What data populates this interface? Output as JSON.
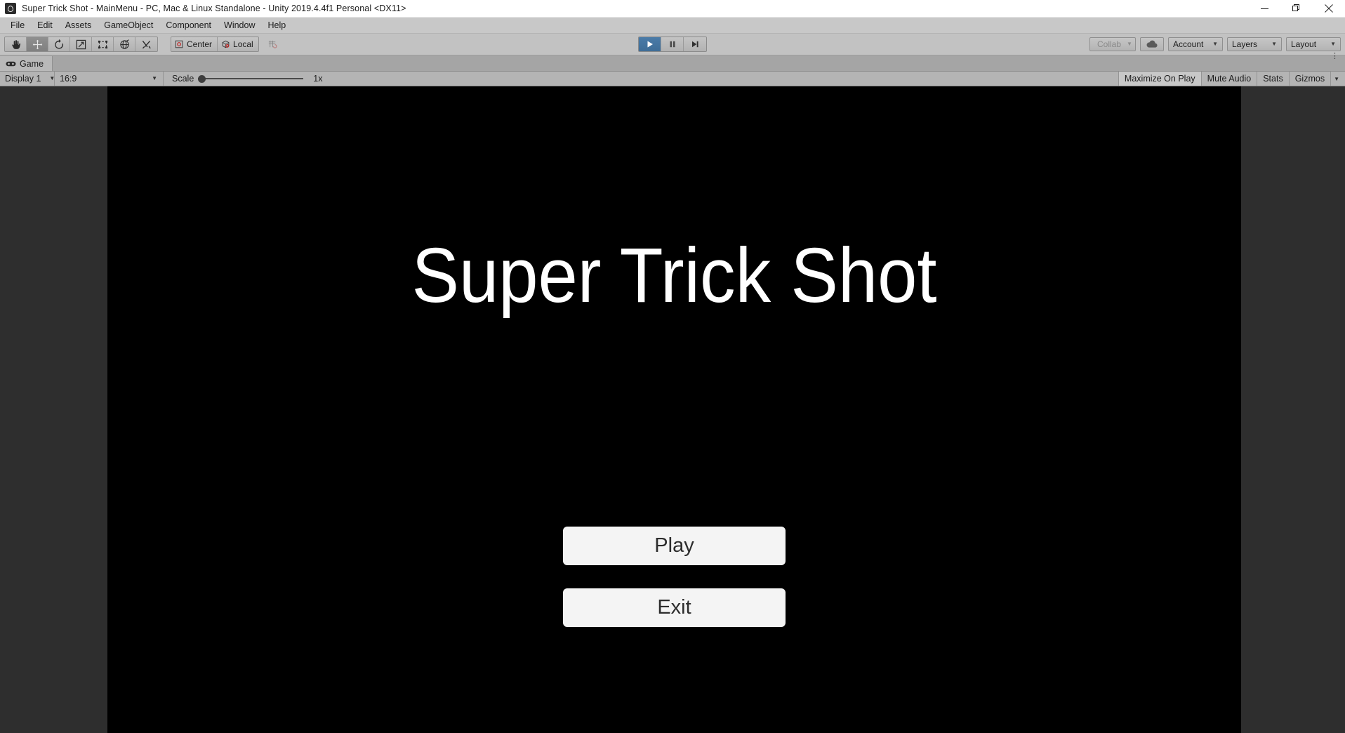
{
  "window": {
    "title": "Super Trick Shot - MainMenu - PC, Mac & Linux Standalone - Unity 2019.4.4f1 Personal <DX11>",
    "app_icon": "unity-icon",
    "controls": {
      "minimize": "minimize-icon",
      "maximize": "restore-icon",
      "close": "close-icon"
    }
  },
  "menubar": {
    "items": [
      {
        "label": "File"
      },
      {
        "label": "Edit"
      },
      {
        "label": "Assets"
      },
      {
        "label": "GameObject"
      },
      {
        "label": "Component"
      },
      {
        "label": "Window"
      },
      {
        "label": "Help"
      }
    ]
  },
  "toolbar": {
    "transform_tools": [
      {
        "name": "hand-tool",
        "icon": "hand-icon",
        "active": false
      },
      {
        "name": "move-tool",
        "icon": "move-arrows-icon",
        "active": true
      },
      {
        "name": "rotate-tool",
        "icon": "rotate-icon",
        "active": false
      },
      {
        "name": "scale-tool",
        "icon": "scale-icon",
        "active": false
      },
      {
        "name": "rect-tool",
        "icon": "rect-transform-icon",
        "active": false
      },
      {
        "name": "transform-tool",
        "icon": "transform-icon",
        "active": false
      },
      {
        "name": "custom-editor-tool",
        "icon": "wrench-screwdriver-icon",
        "active": false
      }
    ],
    "pivot_mode": {
      "label": "Center",
      "icon": "pivot-center-icon"
    },
    "pivot_rotation": {
      "label": "Local",
      "icon": "handle-local-icon"
    },
    "grid_snap": {
      "icon": "grid-snap-icon"
    },
    "playback": {
      "play": {
        "icon": "play-icon",
        "active": true
      },
      "pause": {
        "icon": "pause-icon",
        "active": false
      },
      "step": {
        "icon": "step-icon",
        "active": false
      }
    },
    "collab": {
      "label": "Collab",
      "icon": "collab-check-icon",
      "caret": "▼"
    },
    "cloud": {
      "icon": "cloud-icon"
    },
    "account": {
      "label": "Account",
      "caret": "▼"
    },
    "layers": {
      "label": "Layers",
      "caret": "▼"
    },
    "layout": {
      "label": "Layout",
      "caret": "▼"
    }
  },
  "panel": {
    "tab": {
      "label": "Game",
      "icon": "gamepad-icon"
    },
    "context_menu": "⋮"
  },
  "gameview_toolbar": {
    "display": {
      "value": "Display 1",
      "caret": "▼"
    },
    "aspect": {
      "value": "16:9",
      "caret": "▼"
    },
    "scale": {
      "label": "Scale",
      "value": "1x",
      "percent": 0
    },
    "maximize_on_play": "Maximize On Play",
    "mute_audio": "Mute Audio",
    "stats": "Stats",
    "gizmos": "Gizmos",
    "gizmos_caret": "▼"
  },
  "game": {
    "title": "Super Trick Shot",
    "buttons": [
      {
        "label": "Play",
        "name": "play-button"
      },
      {
        "label": "Exit",
        "name": "exit-button"
      }
    ],
    "background_color": "#000000",
    "button_color": "#f4f4f4",
    "text_color": "#ffffff"
  },
  "colors": {
    "titlebar_bg": "#ffffff",
    "menubar_bg": "#c8c8c8",
    "toolbar_bg": "#c2c2c2",
    "panel_bg": "#2e2e2e",
    "play_active": "#3e6d97"
  }
}
